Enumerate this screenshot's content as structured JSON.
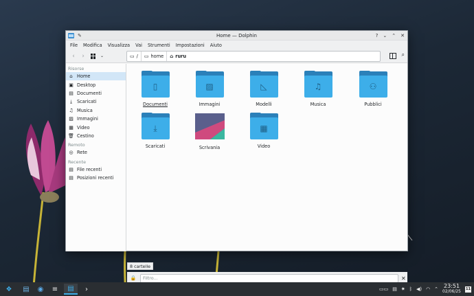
{
  "window": {
    "title": "Home — Dolphin",
    "controls": {
      "help": "?",
      "minimize": "⌄",
      "maximize": "⌃",
      "close": "✕"
    }
  },
  "menubar": [
    "File",
    "Modifica",
    "Visualizza",
    "Vai",
    "Strumenti",
    "Impostazioni",
    "Aiuto"
  ],
  "breadcrumb": {
    "root": "/",
    "home": "home",
    "user": "ruru"
  },
  "sidebar": {
    "sections": [
      {
        "title": "Risorse",
        "items": [
          {
            "label": "Home",
            "icon": "home-icon",
            "active": true
          },
          {
            "label": "Desktop",
            "icon": "desktop-icon"
          },
          {
            "label": "Documenti",
            "icon": "documents-icon"
          },
          {
            "label": "Scaricati",
            "icon": "downloads-icon"
          },
          {
            "label": "Musica",
            "icon": "music-icon"
          },
          {
            "label": "Immagini",
            "icon": "pictures-icon"
          },
          {
            "label": "Video",
            "icon": "video-icon"
          },
          {
            "label": "Cestino",
            "icon": "trash-icon"
          }
        ]
      },
      {
        "title": "Remoto",
        "items": [
          {
            "label": "Rete",
            "icon": "network-icon"
          }
        ]
      },
      {
        "title": "Recente",
        "items": [
          {
            "label": "File recenti",
            "icon": "recent-files-icon"
          },
          {
            "label": "Posizioni recenti",
            "icon": "recent-locations-icon"
          }
        ]
      }
    ]
  },
  "items": [
    {
      "label": "Documenti",
      "icon": "document-folder-icon"
    },
    {
      "label": "Immagini",
      "icon": "pictures-folder-icon"
    },
    {
      "label": "Modelli",
      "icon": "templates-folder-icon"
    },
    {
      "label": "Musica",
      "icon": "music-folder-icon"
    },
    {
      "label": "Pubblici",
      "icon": "public-folder-icon"
    },
    {
      "label": "Scaricati",
      "icon": "downloads-folder-icon"
    },
    {
      "label": "Scrivania",
      "icon": "desktop-folder-thumbnail"
    },
    {
      "label": "Video",
      "icon": "video-folder-icon"
    }
  ],
  "status": "8 cartelle",
  "filter": {
    "placeholder": "Filtro..."
  },
  "clock": {
    "time": "23:51",
    "date": "02/06/25",
    "calendar_day": "11"
  }
}
